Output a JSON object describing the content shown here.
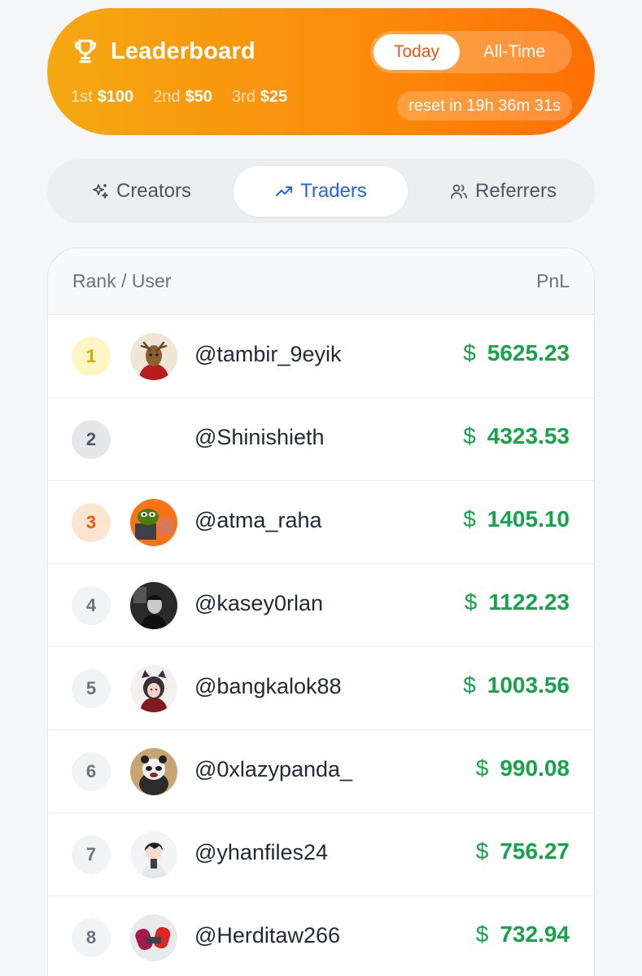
{
  "header": {
    "title": "Leaderboard",
    "toggle": {
      "active": "Today",
      "inactive": "All-Time"
    },
    "prizes": [
      {
        "place": "1st",
        "amount": "$100"
      },
      {
        "place": "2nd",
        "amount": "$50"
      },
      {
        "place": "3rd",
        "amount": "$25"
      }
    ],
    "reset_text": "reset in 19h 36m 31s"
  },
  "tabs": [
    {
      "label": "Creators",
      "icon": "sparkles-icon"
    },
    {
      "label": "Traders",
      "icon": "trending-up-icon",
      "active": true
    },
    {
      "label": "Referrers",
      "icon": "users-icon"
    }
  ],
  "table": {
    "col_user": "Rank / User",
    "col_pnl": "PnL",
    "currency": "$",
    "rows": [
      {
        "rank": "1",
        "user": "@tambir_9eyik",
        "pnl": "5625.23"
      },
      {
        "rank": "2",
        "user": "@Shinishieth",
        "pnl": "4323.53"
      },
      {
        "rank": "3",
        "user": "@atma_raha",
        "pnl": "1405.10"
      },
      {
        "rank": "4",
        "user": "@kasey0rlan",
        "pnl": "1122.23"
      },
      {
        "rank": "5",
        "user": "@bangkalok88",
        "pnl": "1003.56"
      },
      {
        "rank": "6",
        "user": "@0xlazypanda_",
        "pnl": "990.08"
      },
      {
        "rank": "7",
        "user": "@yhanfiles24",
        "pnl": "756.27"
      },
      {
        "rank": "8",
        "user": "@Herditaw266",
        "pnl": "732.94"
      }
    ]
  },
  "colors": {
    "header_gradient_start": "#f5a812",
    "header_gradient_end": "#fe6f04",
    "active_tab": "#2563eb",
    "pnl_positive": "#16a34a"
  }
}
